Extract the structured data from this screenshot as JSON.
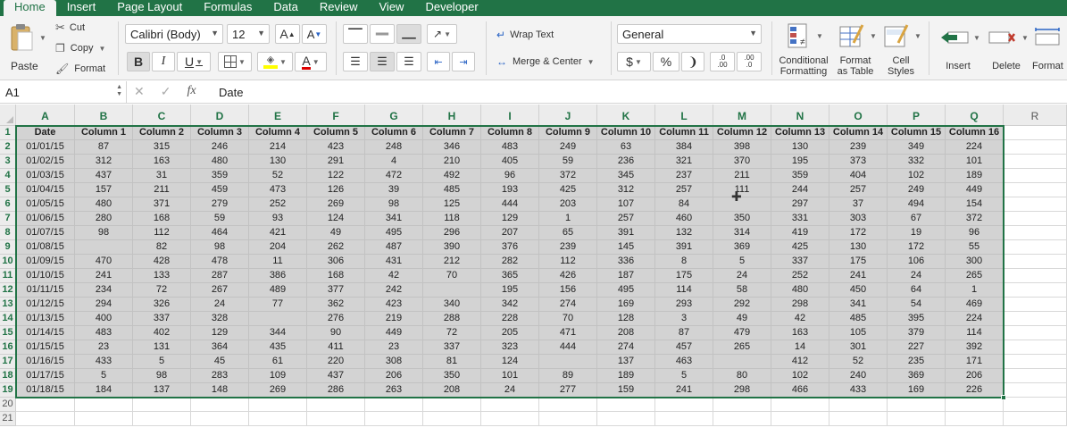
{
  "tabs": [
    "Home",
    "Insert",
    "Page Layout",
    "Formulas",
    "Data",
    "Review",
    "View",
    "Developer"
  ],
  "ribbon": {
    "paste": "Paste",
    "cut": "Cut",
    "copy": "Copy",
    "format_painter": "Format",
    "font_name": "Calibri (Body)",
    "font_size": "12",
    "bold": "B",
    "italic": "I",
    "underline": "U",
    "font_color_letter": "A",
    "grow_font": "A",
    "shrink_font": "A",
    "wrap_text": "Wrap Text",
    "merge_center": "Merge & Center",
    "number_format": "General",
    "currency": "$",
    "percent": "%",
    "comma": "❩",
    "inc_decimal_top": ".0",
    "inc_decimal_bottom": ".00",
    "dec_decimal_top": ".00",
    "dec_decimal_bottom": ".0",
    "conditional_formatting_1": "Conditional",
    "conditional_formatting_2": "Formatting",
    "format_as_table_1": "Format",
    "format_as_table_2": "as Table",
    "cell_styles_1": "Cell",
    "cell_styles_2": "Styles",
    "insert": "Insert",
    "delete": "Delete",
    "format": "Format"
  },
  "formula_bar": {
    "name_box": "A1",
    "fx": "fx",
    "value": "Date"
  },
  "colors": {
    "accent": "#217346",
    "selection": "#d3d3d3",
    "header_bg": "#ececec"
  },
  "sheet": {
    "column_letters": [
      "A",
      "B",
      "C",
      "D",
      "E",
      "F",
      "G",
      "H",
      "I",
      "J",
      "K",
      "L",
      "M",
      "N",
      "O",
      "P",
      "Q",
      "R"
    ],
    "row_numbers": [
      "1",
      "2",
      "3",
      "4",
      "5",
      "6",
      "7",
      "8",
      "9",
      "10",
      "11",
      "12",
      "13",
      "14",
      "15",
      "16",
      "17",
      "18",
      "19",
      "20",
      "21"
    ],
    "header_row": [
      "Date",
      "Column 1",
      "Column 2",
      "Column 3",
      "Column 4",
      "Column 5",
      "Column 6",
      "Column 7",
      "Column 8",
      "Column 9",
      "Column 10",
      "Column 11",
      "Column 12",
      "Column 13",
      "Column 14",
      "Column 15",
      "Column 16"
    ],
    "rows": [
      [
        "01/01/15",
        "87",
        "315",
        "246",
        "214",
        "423",
        "248",
        "346",
        "483",
        "249",
        "63",
        "384",
        "398",
        "130",
        "239",
        "349",
        "224"
      ],
      [
        "01/02/15",
        "312",
        "163",
        "480",
        "130",
        "291",
        "4",
        "210",
        "405",
        "59",
        "236",
        "321",
        "370",
        "195",
        "373",
        "332",
        "101"
      ],
      [
        "01/03/15",
        "437",
        "31",
        "359",
        "52",
        "122",
        "472",
        "492",
        "96",
        "372",
        "345",
        "237",
        "211",
        "359",
        "404",
        "102",
        "189"
      ],
      [
        "01/04/15",
        "157",
        "211",
        "459",
        "473",
        "126",
        "39",
        "485",
        "193",
        "425",
        "312",
        "257",
        "111",
        "244",
        "257",
        "249",
        "449"
      ],
      [
        "01/05/15",
        "480",
        "371",
        "279",
        "252",
        "269",
        "98",
        "125",
        "444",
        "203",
        "107",
        "84",
        "",
        "297",
        "37",
        "494",
        "154"
      ],
      [
        "01/06/15",
        "280",
        "168",
        "59",
        "93",
        "124",
        "341",
        "118",
        "129",
        "1",
        "257",
        "460",
        "350",
        "331",
        "303",
        "67",
        "372"
      ],
      [
        "01/07/15",
        "98",
        "112",
        "464",
        "421",
        "49",
        "495",
        "296",
        "207",
        "65",
        "391",
        "132",
        "314",
        "419",
        "172",
        "19",
        "96"
      ],
      [
        "01/08/15",
        "",
        "82",
        "98",
        "204",
        "262",
        "487",
        "390",
        "376",
        "239",
        "145",
        "391",
        "369",
        "425",
        "130",
        "172",
        "55"
      ],
      [
        "01/09/15",
        "470",
        "428",
        "478",
        "11",
        "306",
        "431",
        "212",
        "282",
        "112",
        "336",
        "8",
        "5",
        "337",
        "175",
        "106",
        "300"
      ],
      [
        "01/10/15",
        "241",
        "133",
        "287",
        "386",
        "168",
        "42",
        "70",
        "365",
        "426",
        "187",
        "175",
        "24",
        "252",
        "241",
        "24",
        "265"
      ],
      [
        "01/11/15",
        "234",
        "72",
        "267",
        "489",
        "377",
        "242",
        "",
        "195",
        "156",
        "495",
        "114",
        "58",
        "480",
        "450",
        "64",
        "1"
      ],
      [
        "01/12/15",
        "294",
        "326",
        "24",
        "77",
        "362",
        "423",
        "340",
        "342",
        "274",
        "169",
        "293",
        "292",
        "298",
        "341",
        "54",
        "469"
      ],
      [
        "01/13/15",
        "400",
        "337",
        "328",
        "",
        "276",
        "219",
        "288",
        "228",
        "70",
        "128",
        "3",
        "49",
        "42",
        "485",
        "395",
        "224"
      ],
      [
        "01/14/15",
        "483",
        "402",
        "129",
        "344",
        "90",
        "449",
        "72",
        "205",
        "471",
        "208",
        "87",
        "479",
        "163",
        "105",
        "379",
        "114"
      ],
      [
        "01/15/15",
        "23",
        "131",
        "364",
        "435",
        "411",
        "23",
        "337",
        "323",
        "444",
        "274",
        "457",
        "265",
        "14",
        "301",
        "227",
        "392"
      ],
      [
        "01/16/15",
        "433",
        "5",
        "45",
        "61",
        "220",
        "308",
        "81",
        "124",
        "",
        "137",
        "463",
        "",
        "412",
        "52",
        "235",
        "171"
      ],
      [
        "01/17/15",
        "5",
        "98",
        "283",
        "109",
        "437",
        "206",
        "350",
        "101",
        "89",
        "189",
        "5",
        "80",
        "102",
        "240",
        "369",
        "206"
      ],
      [
        "01/18/15",
        "184",
        "137",
        "148",
        "269",
        "286",
        "263",
        "208",
        "24",
        "277",
        "159",
        "241",
        "298",
        "466",
        "433",
        "169",
        "226"
      ]
    ]
  }
}
